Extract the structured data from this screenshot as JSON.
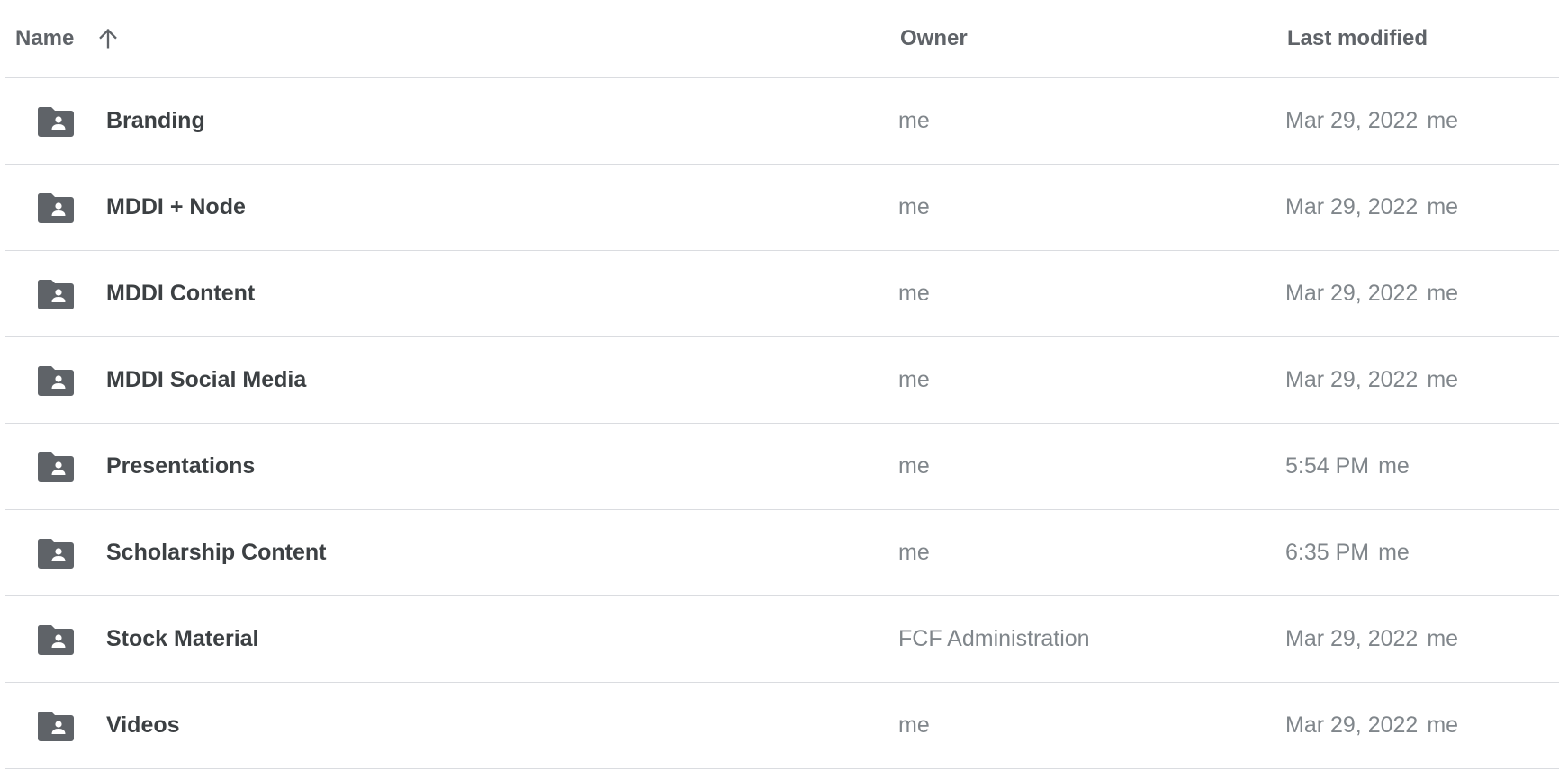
{
  "header": {
    "name_label": "Name",
    "owner_label": "Owner",
    "modified_label": "Last modified",
    "sort_icon": "arrow-up-icon"
  },
  "colors": {
    "folder": "#5f6368",
    "divider": "#dadce0",
    "primary_text": "#3c4043",
    "secondary_text": "#80868b"
  },
  "rows": [
    {
      "name": "Branding",
      "owner": "me",
      "modified": "Mar 29, 2022",
      "modified_by": "me",
      "icon": "shared-folder-icon"
    },
    {
      "name": "MDDI + Node",
      "owner": "me",
      "modified": "Mar 29, 2022",
      "modified_by": "me",
      "icon": "shared-folder-icon"
    },
    {
      "name": "MDDI Content",
      "owner": "me",
      "modified": "Mar 29, 2022",
      "modified_by": "me",
      "icon": "shared-folder-icon"
    },
    {
      "name": "MDDI Social Media",
      "owner": "me",
      "modified": "Mar 29, 2022",
      "modified_by": "me",
      "icon": "shared-folder-icon"
    },
    {
      "name": "Presentations",
      "owner": "me",
      "modified": "5:54 PM",
      "modified_by": "me",
      "icon": "shared-folder-icon"
    },
    {
      "name": "Scholarship Content",
      "owner": "me",
      "modified": "6:35 PM",
      "modified_by": "me",
      "icon": "shared-folder-icon"
    },
    {
      "name": "Stock Material",
      "owner": "FCF Administration",
      "modified": "Mar 29, 2022",
      "modified_by": "me",
      "icon": "shared-folder-icon"
    },
    {
      "name": "Videos",
      "owner": "me",
      "modified": "Mar 29, 2022",
      "modified_by": "me",
      "icon": "shared-folder-icon"
    }
  ]
}
